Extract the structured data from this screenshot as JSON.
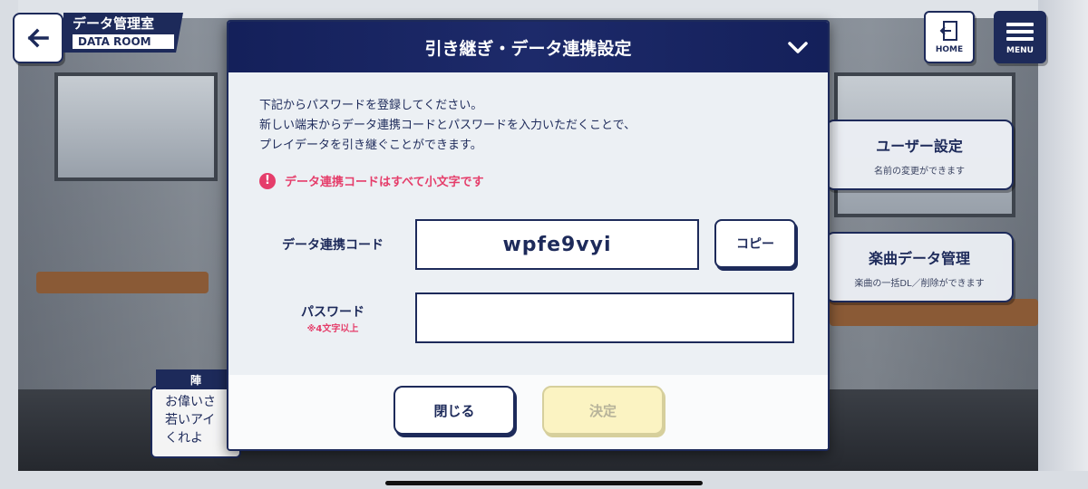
{
  "header": {
    "room_title_jp": "データ管理室",
    "room_title_en": "DATA ROOM",
    "home_label": "HOME",
    "menu_label": "MENU"
  },
  "side_cards": [
    {
      "title": "ユーザー設定",
      "subtitle": "名前の変更ができます"
    },
    {
      "title": "楽曲データ管理",
      "subtitle": "楽曲の一括DL／削除ができます"
    }
  ],
  "dialogue": {
    "speaker": "陣",
    "lines": [
      "お偉いさ",
      "若いアイ",
      "くれよ"
    ]
  },
  "modal": {
    "title": "引き継ぎ・データ連携設定",
    "instructions": [
      "下記からパスワードを登録してください。",
      "新しい端末からデータ連携コードとパスワードを入力いただくことで、",
      "プレイデータを引き継ぐことができます。"
    ],
    "warning": "データ連携コードはすべて小文字です",
    "code_label": "データ連携コード",
    "code_value": "wpfe9vyi",
    "copy_label": "コピー",
    "password_label": "パスワード",
    "password_note": "※4文字以上",
    "password_value": "",
    "close_label": "閉じる",
    "confirm_label": "決定"
  },
  "colors": {
    "navy": "#1d2a5a",
    "warning": "#e53d6a",
    "confirm_disabled_bg": "#fbf3c2"
  },
  "icons": {
    "back": "back-arrow-icon",
    "home": "exit-door-icon",
    "menu": "hamburger-icon",
    "collapse": "chevron-down-icon",
    "warning": "exclamation-icon"
  }
}
